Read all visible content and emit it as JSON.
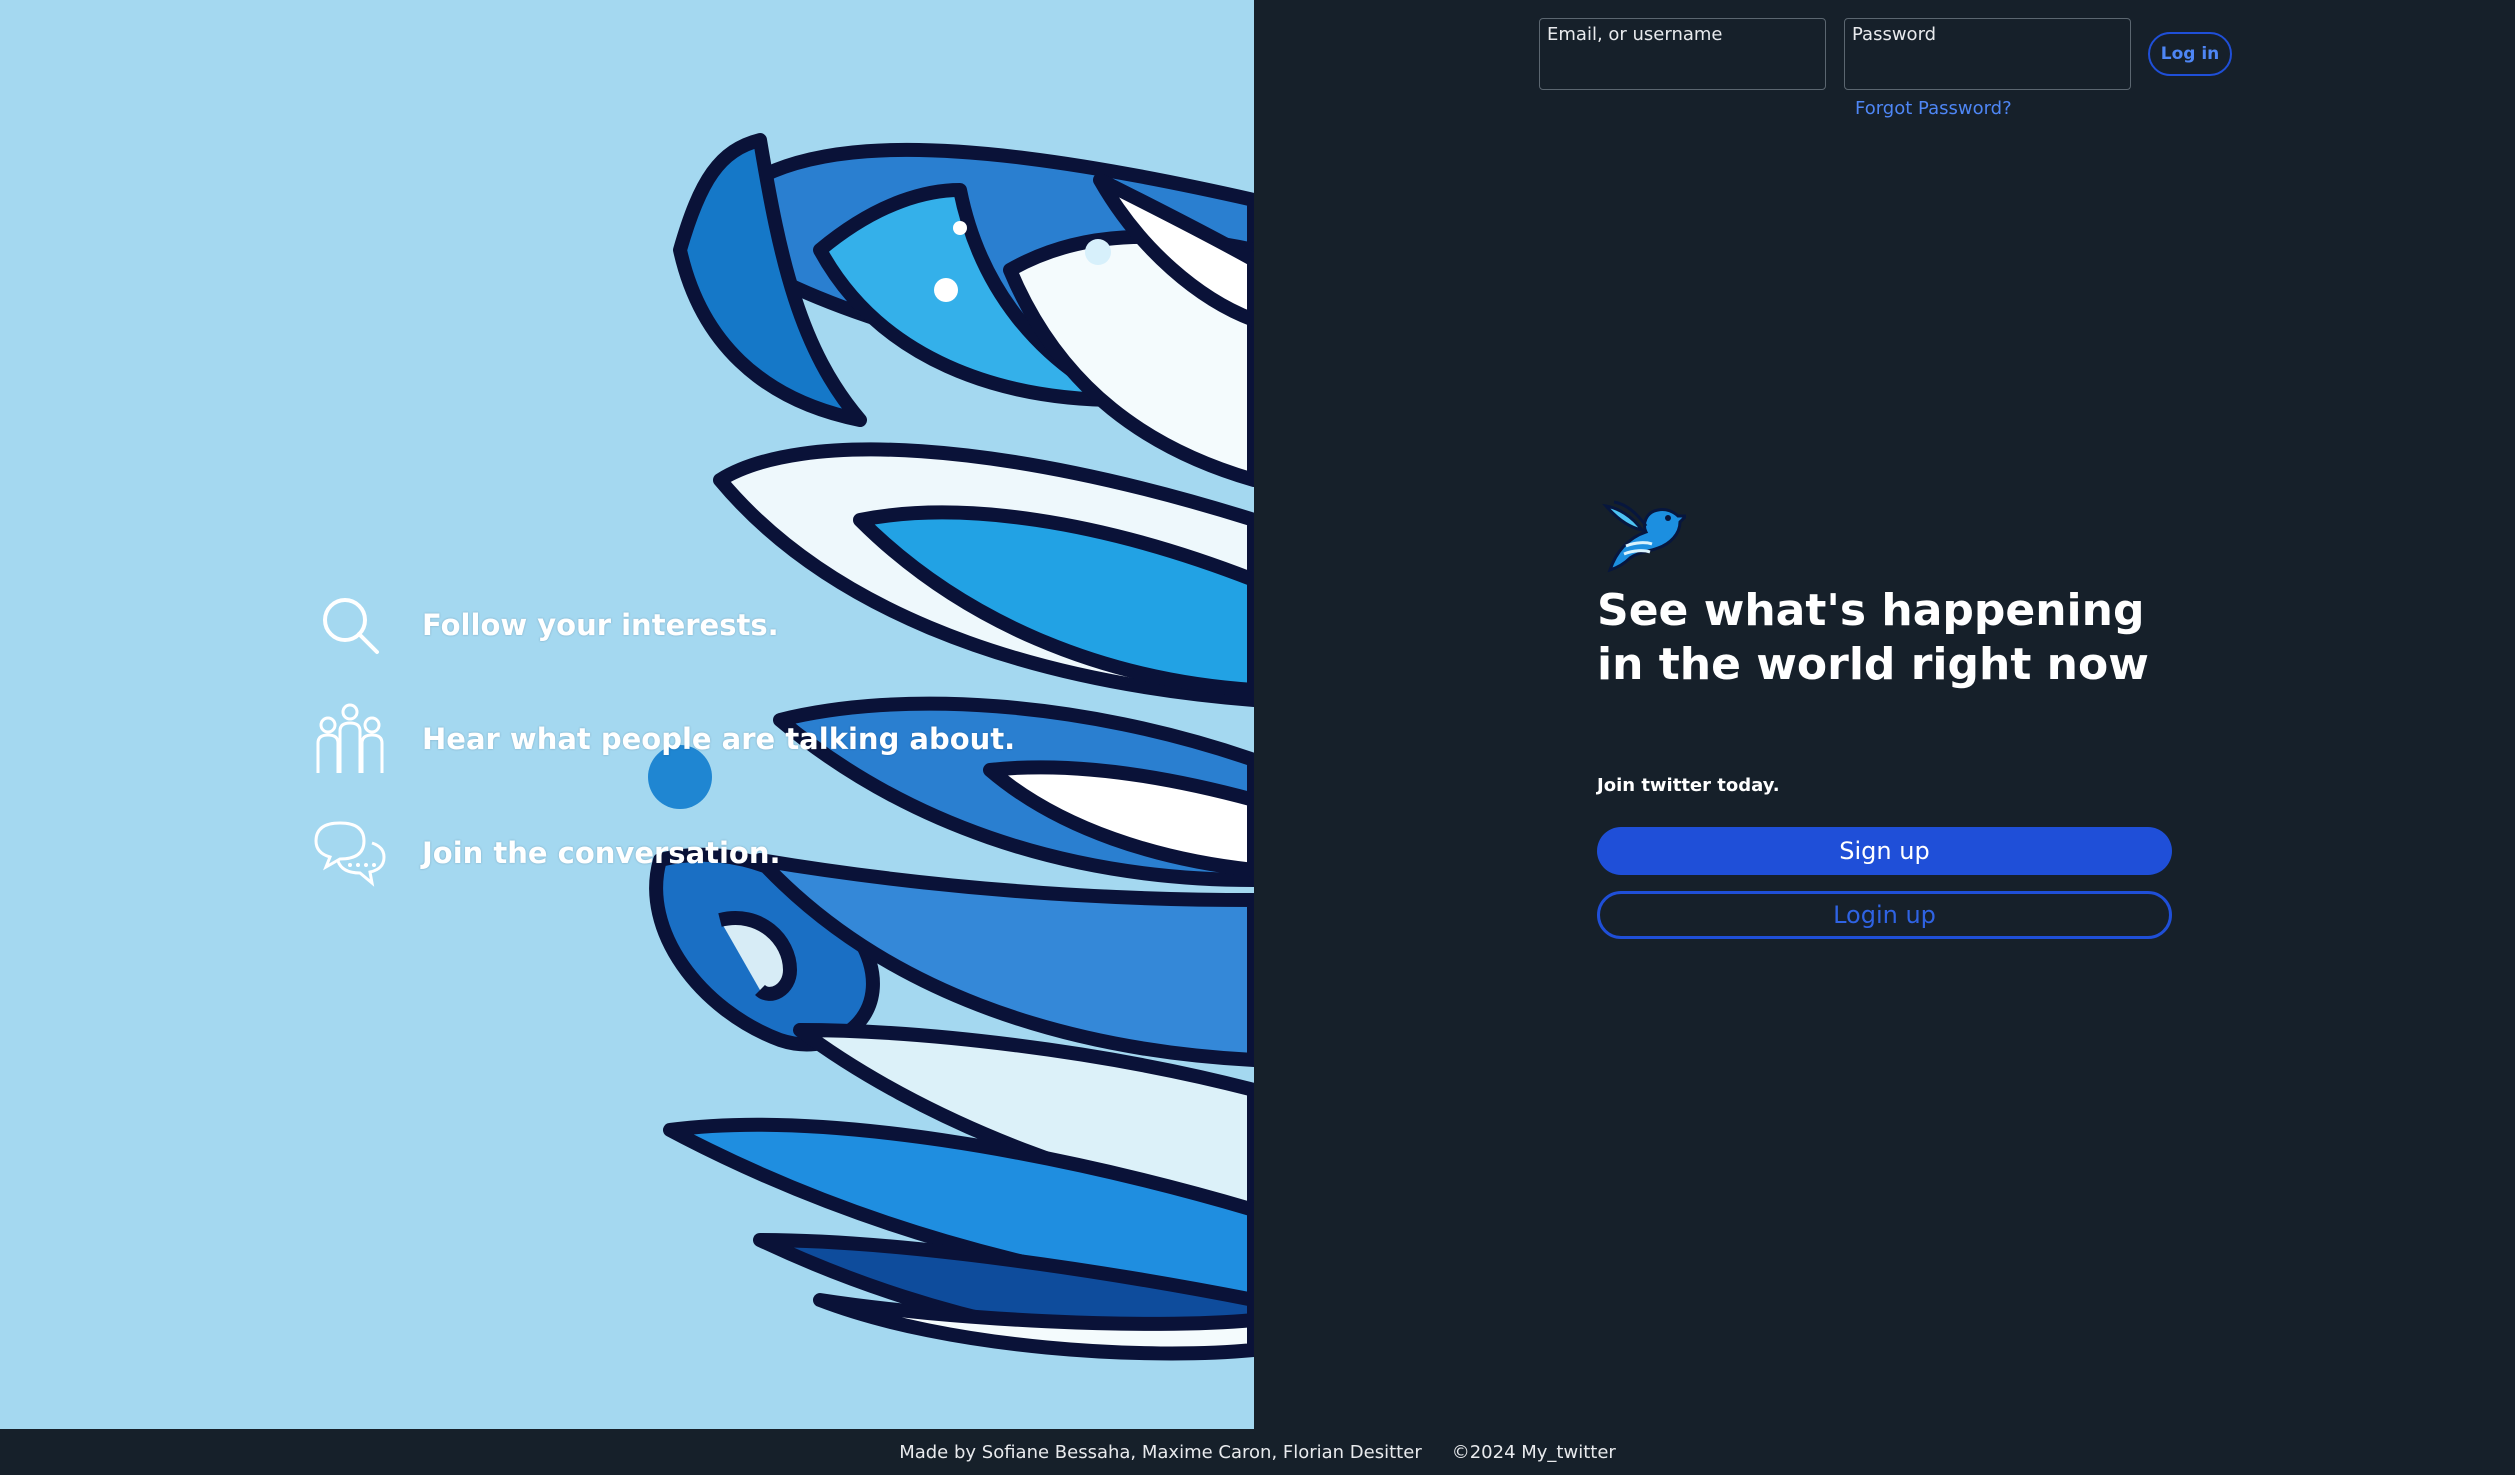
{
  "hero": {
    "features": [
      {
        "icon": "search-icon",
        "text": "Follow your interests."
      },
      {
        "icon": "people-icon",
        "text": "Hear what people are talking about."
      },
      {
        "icon": "chat-bubbles-icon",
        "text": "Join the conversation."
      }
    ]
  },
  "login_form": {
    "email_label": "Email, or username",
    "email_value": "",
    "password_label": "Password",
    "password_value": "",
    "login_button": "Log in",
    "forgot_link": "Forgot Password?"
  },
  "main": {
    "logo_icon": "bird-logo-icon",
    "headline": "See what's happening in the world right now",
    "join_text": "Join twitter today.",
    "signup_button": "Sign up",
    "login_button": "Login up"
  },
  "footer": {
    "credits": "Made by Sofiane Bessaha, Maxime Caron, Florian Desitter",
    "copyright": "©2024 My_twitter"
  },
  "colors": {
    "panel_bg": "#16202a",
    "hero_bg": "#a4d8f0",
    "accent": "#1f4fd8",
    "link": "#4e86f5"
  }
}
